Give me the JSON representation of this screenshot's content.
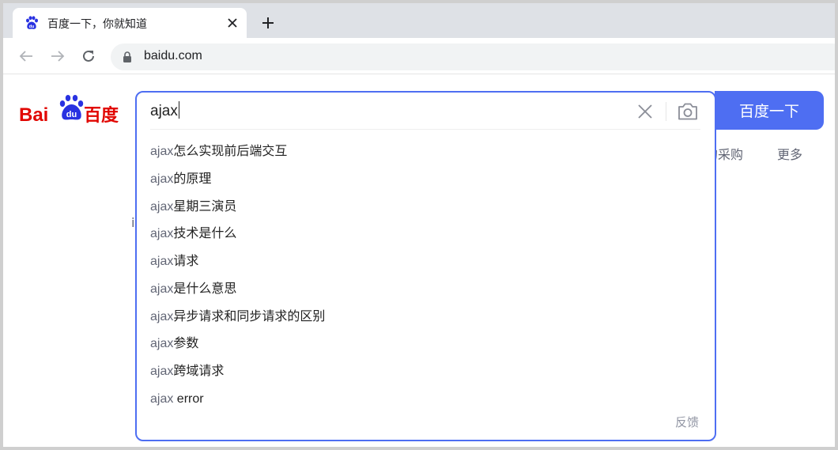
{
  "browser": {
    "tab_title": "百度一下，你就知道",
    "url": "baidu.com"
  },
  "page": {
    "logo_text_left": "Bai",
    "logo_text_paw": "du",
    "logo_text_right": "百度",
    "search_button_label": "百度一下",
    "behind_links": [
      "的采购",
      "更多"
    ],
    "behind_letter": "i"
  },
  "search": {
    "query": "ajax",
    "suggestions": [
      {
        "q": "ajax",
        "rest": "怎么实现前后端交互"
      },
      {
        "q": "ajax",
        "rest": "的原理"
      },
      {
        "q": "ajax",
        "rest": "星期三演员"
      },
      {
        "q": "ajax",
        "rest": "技术是什么"
      },
      {
        "q": "ajax",
        "rest": "请求"
      },
      {
        "q": "ajax",
        "rest": "是什么意思"
      },
      {
        "q": "ajax",
        "rest": "异步请求和同步请求的区别"
      },
      {
        "q": "ajax",
        "rest": "参数"
      },
      {
        "q": "ajax",
        "rest": "跨域请求"
      },
      {
        "q": "ajax",
        "rest": " error"
      }
    ],
    "feedback_label": "反馈"
  },
  "colors": {
    "accent": "#4e6ef2",
    "logo_red": "#e10601",
    "logo_blue": "#2932e1"
  }
}
